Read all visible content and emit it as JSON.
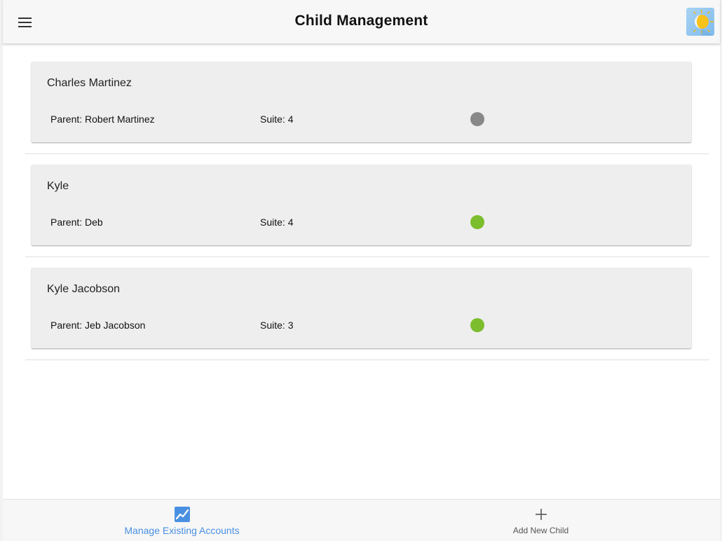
{
  "header": {
    "title": "Child Management",
    "menu_icon": "hamburger-menu-icon",
    "logo_icon": "sun-moon-logo-icon"
  },
  "children": [
    {
      "name": "Charles Martinez",
      "parent": "Parent: Robert Martinez",
      "suite": "Suite: 4",
      "status_color": "#888888"
    },
    {
      "name": "Kyle",
      "parent": "Parent: Deb",
      "suite": "Suite: 4",
      "status_color": "#7cbd2e"
    },
    {
      "name": "Kyle Jacobson",
      "parent": "Parent: Jeb Jacobson",
      "suite": "Suite: 3",
      "status_color": "#7cbd2e"
    }
  ],
  "bottom_nav": {
    "tabs": [
      {
        "label": "Manage Existing Accounts",
        "icon": "chart-line-icon",
        "active": true
      },
      {
        "label": "Add New Child",
        "icon": "plus-icon",
        "active": false
      }
    ]
  },
  "colors": {
    "accent": "#4a90e2",
    "inactive": "#555555",
    "card_bg": "#eeeeee"
  }
}
